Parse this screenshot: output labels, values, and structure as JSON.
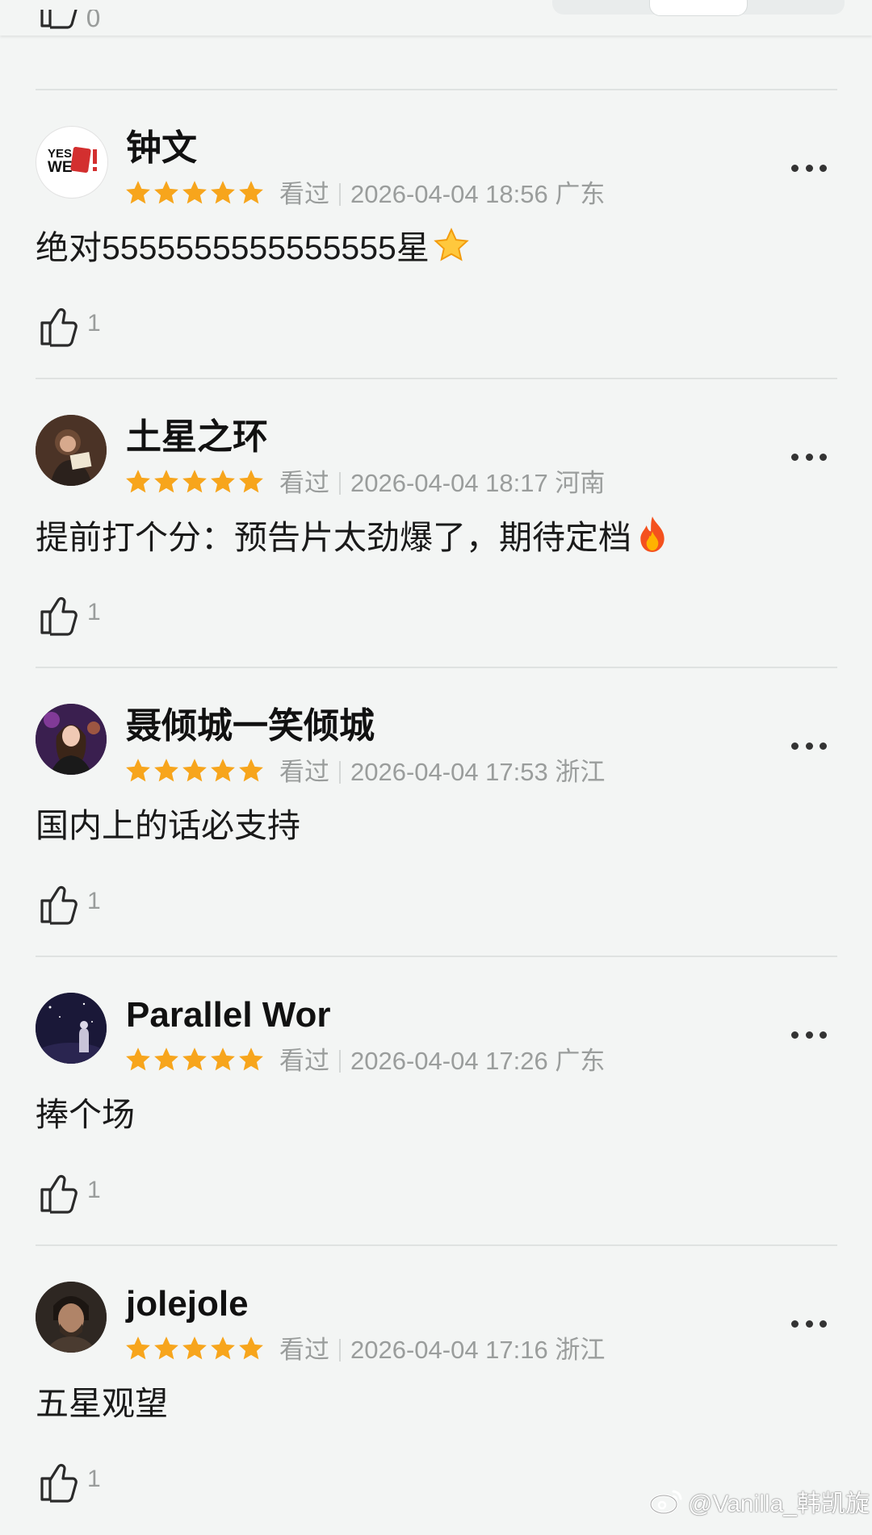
{
  "colors": {
    "background": "#f3f5f4",
    "star": "#f7a51c",
    "meta_text": "#9a9d9c"
  },
  "previous_comment": {
    "like_count": "0"
  },
  "comments": [
    {
      "username": "钟文",
      "rating_stars": 5,
      "status": "看过",
      "datetime": "2026-04-04 18:56",
      "location": "广东",
      "text": "绝对5555555555555555星",
      "emoji": "star-emoji",
      "like_count": "1",
      "avatar_logo_text": "YES WE"
    },
    {
      "username": "土星之环",
      "rating_stars": 5,
      "status": "看过",
      "datetime": "2026-04-04 18:17",
      "location": "河南",
      "text": "提前打个分：预告片太劲爆了，期待定档",
      "emoji": "fire-emoji",
      "like_count": "1"
    },
    {
      "username": "聂倾城一笑倾城",
      "rating_stars": 5,
      "status": "看过",
      "datetime": "2026-04-04 17:53",
      "location": "浙江",
      "text": "国内上的话必支持",
      "like_count": "1"
    },
    {
      "username": "Parallel Wor",
      "rating_stars": 5,
      "status": "看过",
      "datetime": "2026-04-04 17:26",
      "location": "广东",
      "text": "捧个场",
      "like_count": "1"
    },
    {
      "username": "jolejole",
      "rating_stars": 5,
      "status": "看过",
      "datetime": "2026-04-04 17:16",
      "location": "浙江",
      "text": "五星观望",
      "like_count": "1"
    }
  ],
  "watermark": {
    "text": "@Vanilla_韩凯旋",
    "icon": "weibo-logo-icon"
  }
}
